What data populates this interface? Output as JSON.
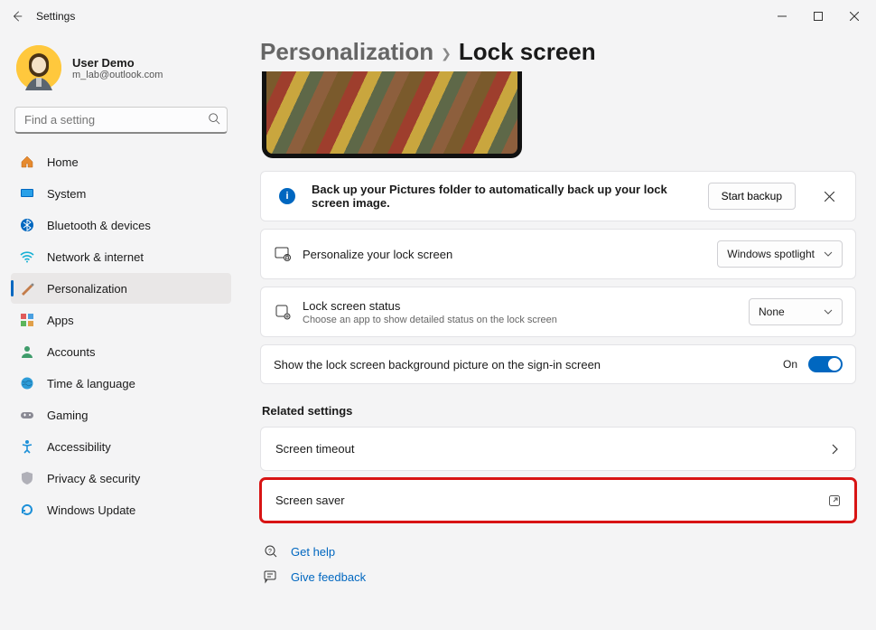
{
  "app": {
    "title": "Settings"
  },
  "user": {
    "name": "User Demo",
    "email": "m_lab@outlook.com"
  },
  "search": {
    "placeholder": "Find a setting"
  },
  "nav": {
    "home": "Home",
    "system": "System",
    "bluetooth": "Bluetooth & devices",
    "network": "Network & internet",
    "personalization": "Personalization",
    "apps": "Apps",
    "accounts": "Accounts",
    "time": "Time & language",
    "gaming": "Gaming",
    "accessibility": "Accessibility",
    "privacy": "Privacy & security",
    "update": "Windows Update"
  },
  "breadcrumb": {
    "parent": "Personalization",
    "current": "Lock screen"
  },
  "backup": {
    "message": "Back up your Pictures folder to automatically back up your lock screen image.",
    "button": "Start backup"
  },
  "personalize": {
    "label": "Personalize your lock screen",
    "dropdown": "Windows spotlight"
  },
  "status": {
    "title": "Lock screen status",
    "sub": "Choose an app to show detailed status on the lock screen",
    "dropdown": "None"
  },
  "signin": {
    "label": "Show the lock screen background picture on the sign-in screen",
    "state": "On"
  },
  "related": {
    "header": "Related settings",
    "screen_timeout": "Screen timeout",
    "screen_saver": "Screen saver"
  },
  "help": {
    "get_help": "Get help",
    "feedback": "Give feedback"
  }
}
